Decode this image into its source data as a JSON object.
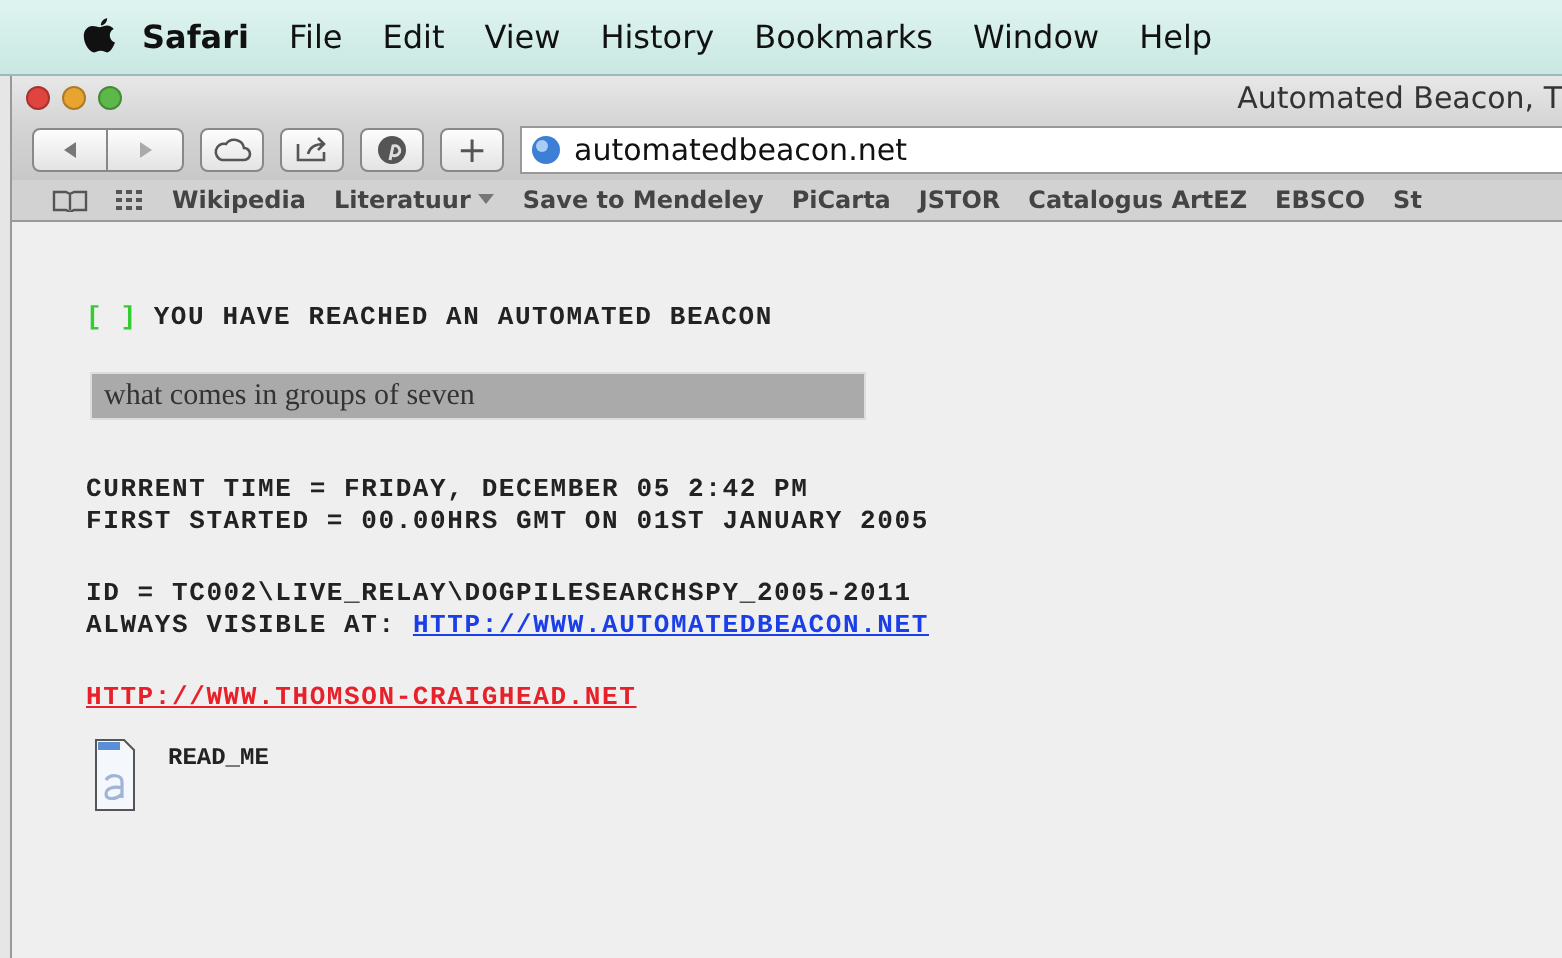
{
  "menu_bar": {
    "app": "Safari",
    "items": [
      "File",
      "Edit",
      "View",
      "History",
      "Bookmarks",
      "Window",
      "Help"
    ]
  },
  "window": {
    "title": "Automated Beacon, T"
  },
  "toolbar": {
    "address": "automatedbeacon.net",
    "new_tab": "+"
  },
  "bookmarks": [
    {
      "label": "Wikipedia",
      "menu": false
    },
    {
      "label": "Literatuur",
      "menu": true
    },
    {
      "label": "Save to Mendeley",
      "menu": false
    },
    {
      "label": "PiCarta",
      "menu": false
    },
    {
      "label": "JSTOR",
      "menu": false
    },
    {
      "label": "Catalogus ArtEZ",
      "menu": false
    },
    {
      "label": "EBSCO",
      "menu": false
    },
    {
      "label": "St",
      "menu": false
    }
  ],
  "page": {
    "checkbox": "[ ]",
    "heading": "YOU HAVE REACHED AN AUTOMATED BEACON",
    "message": "what comes in groups of seven",
    "lines": [
      {
        "kind": "text",
        "text": "CURRENT TIME = FRIDAY, DECEMBER 05 2:42 PM"
      },
      {
        "kind": "text",
        "text": "FIRST STARTED = 00.00HRS GMT ON 01ST JANUARY 2005"
      },
      {
        "kind": "gap"
      },
      {
        "kind": "text",
        "text": "ID = TC002\\LIVE_RELAY\\DOGPILESEARCHSPY_2005-2011"
      },
      {
        "kind": "labeled_link",
        "text": "ALWAYS VISIBLE AT:",
        "link": "HTTP://WWW.AUTOMATEDBEACON.NET"
      }
    ],
    "footer_link": "HTTP://WWW.THOMSON-CRAIGHEAD.NET",
    "file": "READ_ME"
  }
}
